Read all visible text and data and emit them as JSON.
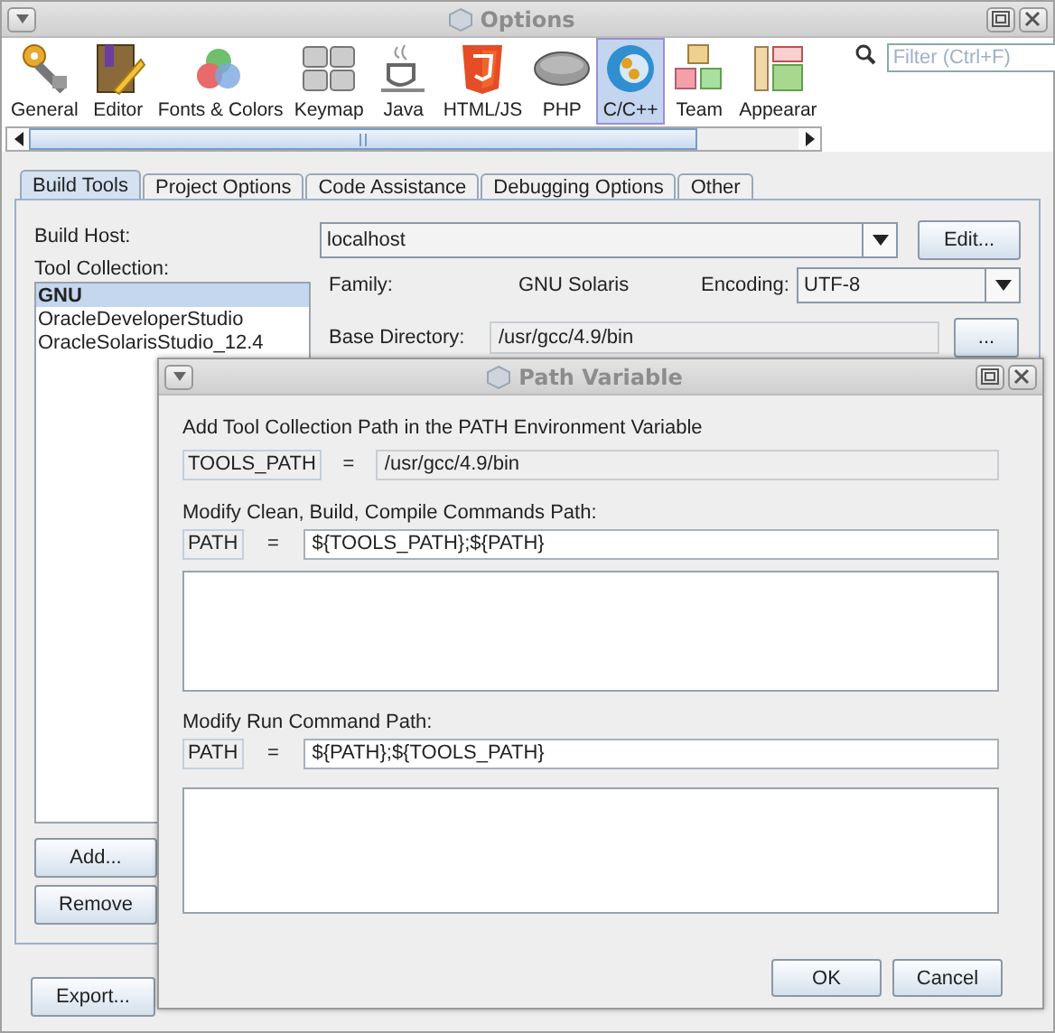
{
  "window": {
    "title": "Options"
  },
  "categories": [
    {
      "label": "General",
      "selected": false
    },
    {
      "label": "Editor",
      "selected": false
    },
    {
      "label": "Fonts & Colors",
      "selected": false
    },
    {
      "label": "Keymap",
      "selected": false
    },
    {
      "label": "Java",
      "selected": false
    },
    {
      "label": "HTML/JS",
      "selected": false
    },
    {
      "label": "PHP",
      "selected": false
    },
    {
      "label": "C/C++",
      "selected": true
    },
    {
      "label": "Team",
      "selected": false
    },
    {
      "label": "Appearar",
      "selected": false
    }
  ],
  "filter": {
    "placeholder": "Filter (Ctrl+F)"
  },
  "tabs": [
    {
      "label": "Build Tools",
      "selected": true
    },
    {
      "label": "Project Options",
      "selected": false
    },
    {
      "label": "Code Assistance",
      "selected": false
    },
    {
      "label": "Debugging Options",
      "selected": false
    },
    {
      "label": "Other",
      "selected": false
    }
  ],
  "build_tools": {
    "build_host_label": "Build Host:",
    "build_host": "localhost",
    "edit_button": "Edit...",
    "tool_collection_label": "Tool Collection:",
    "tool_collections": [
      {
        "label": "GNU",
        "selected": true
      },
      {
        "label": "OracleDeveloperStudio",
        "selected": false
      },
      {
        "label": "OracleSolarisStudio_12.4",
        "selected": false
      }
    ],
    "family_label": "Family:",
    "family": "GNU Solaris",
    "encoding_label": "Encoding:",
    "encoding": "UTF-8",
    "base_directory_label": "Base Directory:",
    "base_directory": "/usr/gcc/4.9/bin",
    "browse_button": "...",
    "add_button": "Add...",
    "remove_button": "Remove"
  },
  "export_button": "Export...",
  "dialog": {
    "title": "Path Variable",
    "heading": "Add Tool Collection Path in the PATH Environment Variable",
    "tools_path": {
      "name": "TOOLS_PATH",
      "equals": "=",
      "value": "/usr/gcc/4.9/bin"
    },
    "sections": [
      {
        "label": "Modify Clean, Build, Compile Commands Path:",
        "name": "PATH",
        "equals": "=",
        "value": "${TOOLS_PATH};${PATH}"
      },
      {
        "label": "Modify Run Command Path:",
        "name": "PATH",
        "equals": "=",
        "value": "${PATH};${TOOLS_PATH}"
      }
    ],
    "buttons": [
      "OK",
      "Cancel"
    ]
  }
}
